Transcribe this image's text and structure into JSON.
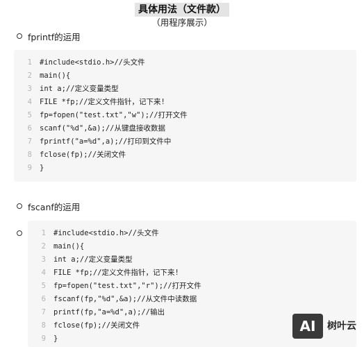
{
  "header": {
    "title": "具体用法（文件款）",
    "subtitle": "（用程序展示）"
  },
  "sections": [
    {
      "heading": "fprintf的运用",
      "code": [
        {
          "n": "1",
          "text": "#include<stdio.h>//头文件"
        },
        {
          "n": "2",
          "text": "main(){"
        },
        {
          "n": "3",
          "text": "int a;//定义变量类型"
        },
        {
          "n": "4",
          "text": "FILE *fp;//定义文件指针，记下来!"
        },
        {
          "n": "5",
          "text": "fp=fopen(\"test.txt\",\"w\");//打开文件"
        },
        {
          "n": "6",
          "text": "scanf(\"%d\",&a);//从键盘接收数据"
        },
        {
          "n": "7",
          "text": "fprintf(\"a=%d\",a);//打印到文件中"
        },
        {
          "n": "8",
          "text": "fclose(fp);//关闭文件"
        },
        {
          "n": "9",
          "text": "}"
        }
      ]
    },
    {
      "heading": "fscanf的运用",
      "code": [
        {
          "n": "1",
          "text": "#include<stdio.h>//头文件"
        },
        {
          "n": "2",
          "text": "main(){"
        },
        {
          "n": "3",
          "text": "int a;//定义变量类型"
        },
        {
          "n": "4",
          "text": "FILE *fp;//定义文件指针，记下来!"
        },
        {
          "n": "5",
          "text": "fp=fopen(\"test.txt\",\"r\");//打开文件"
        },
        {
          "n": "6",
          "text": "fscanf(fp,\"%d\",&a);//从文件中读数据"
        },
        {
          "n": "7",
          "text": "printf(fp,\"a=%d\",a);//输出"
        },
        {
          "n": "8",
          "text": "fclose(fp);//关闭文件"
        },
        {
          "n": "9",
          "text": "}"
        }
      ]
    }
  ],
  "watermark": {
    "badge": "AI",
    "text": "树叶云"
  }
}
